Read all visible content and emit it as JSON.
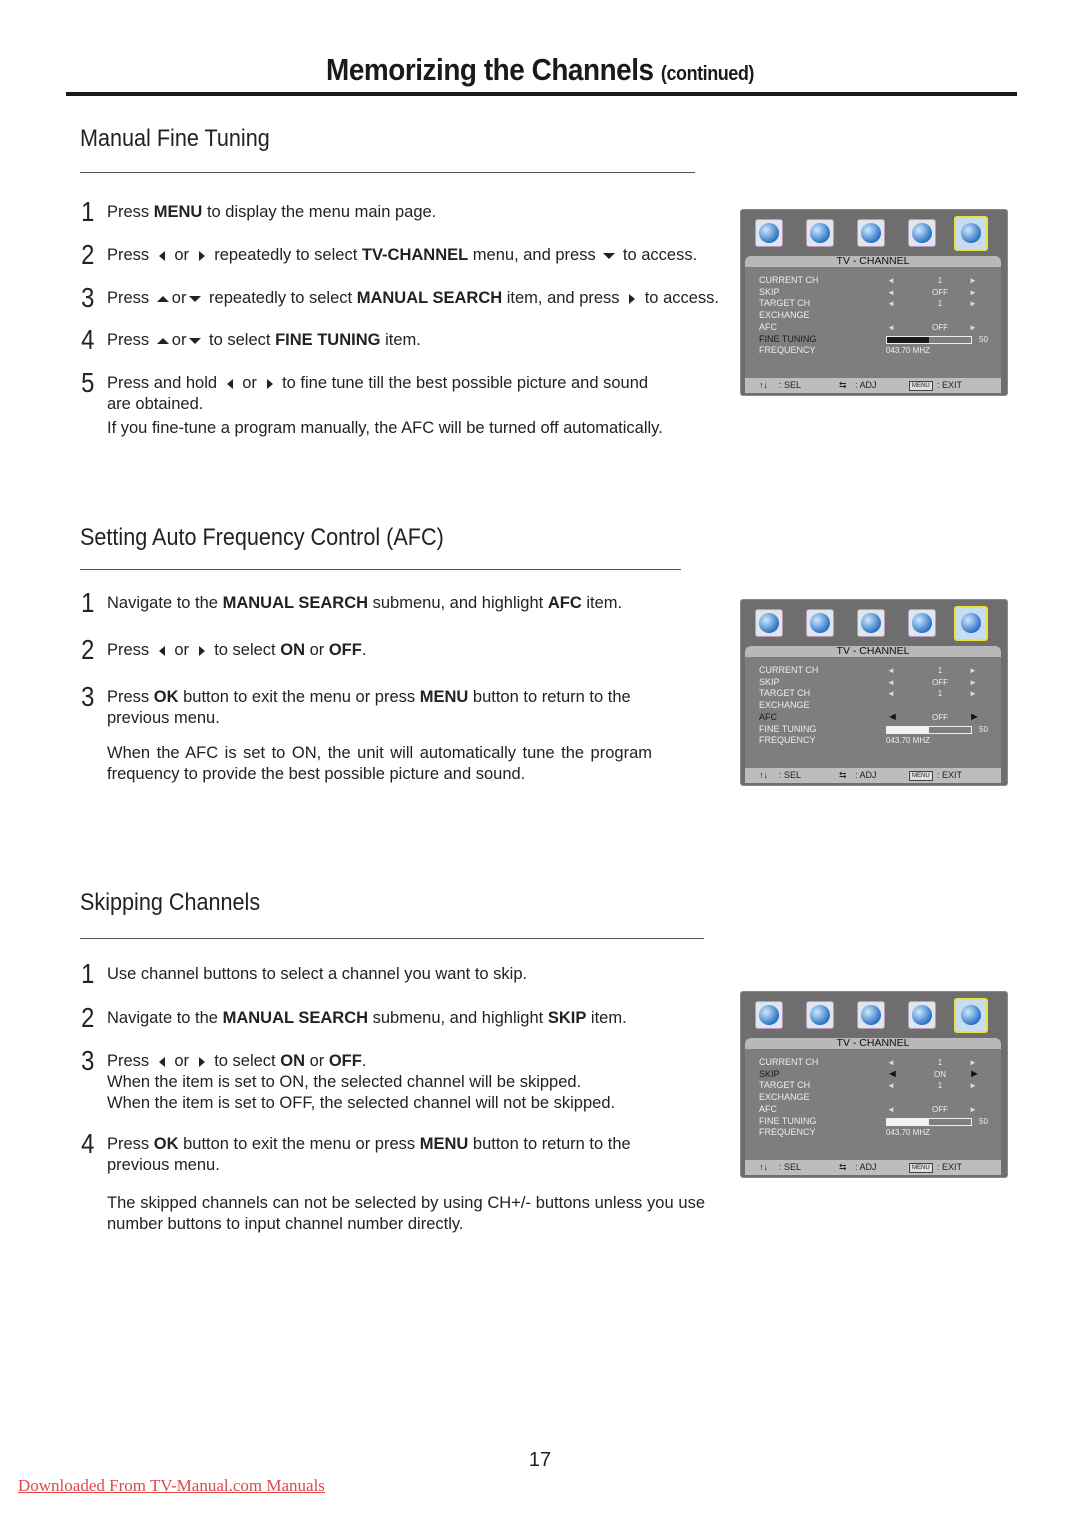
{
  "header": {
    "title": "Memorizing the Channels",
    "title_suffix": "(continued)"
  },
  "sections": [
    {
      "title": "Manual Fine Tuning",
      "steps": [
        {
          "num": "1",
          "parts": [
            "Press ",
            {
              "b": "MENU"
            },
            " to display the menu main page."
          ]
        },
        {
          "num": "2",
          "parts": [
            "Press ",
            {
              "icon": "left"
            },
            " or ",
            {
              "icon": "right"
            },
            " repeatedly to select ",
            {
              "b": "TV-CHANNEL"
            },
            " menu, and press ",
            {
              "icon": "down"
            },
            " to access."
          ]
        },
        {
          "num": "3",
          "parts": [
            "Press ",
            {
              "icon": "up"
            },
            "or",
            {
              "icon": "down"
            },
            " repeatedly to select ",
            {
              "b": "MANUAL SEARCH"
            },
            " item, and  press ",
            {
              "icon": "right"
            },
            " to access."
          ]
        },
        {
          "num": "4",
          "parts": [
            "Press ",
            {
              "icon": "up"
            },
            "or",
            {
              "icon": "down"
            },
            " to select ",
            {
              "b": "FINE TUNING"
            },
            " item."
          ]
        },
        {
          "num": "5",
          "parts": [
            "Press and hold ",
            {
              "icon": "left"
            },
            " or ",
            {
              "icon": "right"
            },
            " to fine tune till the best possible picture and sound"
          ],
          "cont": "are obtained."
        }
      ],
      "note": "If you fine-tune a program manually, the AFC will be turned off automatically.",
      "osd": {
        "highlight": "FINE TUNING",
        "skip": "OFF",
        "bar_fill": "dark"
      }
    },
    {
      "title": "Setting Auto Frequency Control (AFC)",
      "steps": [
        {
          "num": "1",
          "parts": [
            "Navigate to the ",
            {
              "b": "MANUAL SEARCH"
            },
            " submenu, and highlight  ",
            {
              "b": "AFC"
            },
            " item."
          ]
        },
        {
          "num": "2",
          "parts": [
            "Press ",
            {
              "icon": "left"
            },
            " or ",
            {
              "icon": "right"
            },
            " to select ",
            {
              "b": "ON"
            },
            " or ",
            {
              "b": "OFF"
            },
            "."
          ]
        },
        {
          "num": "3",
          "parts": [
            "Press ",
            {
              "b": "OK"
            },
            " button to exit the menu  or press  ",
            {
              "b": "MENU"
            },
            "  button to return to the"
          ],
          "cont": "previous menu."
        }
      ],
      "note": "When the AFC is set to ON, the unit will automatically tune the program frequency to provide the best possible picture and sound.",
      "osd": {
        "highlight": "AFC",
        "skip": "OFF",
        "bar_fill": "light"
      }
    },
    {
      "title": "Skipping Channels",
      "steps": [
        {
          "num": "1",
          "parts": [
            "Use channel buttons to select a channel you want to skip."
          ]
        },
        {
          "num": "2",
          "parts": [
            "Navigate to the ",
            {
              "b": "MANUAL SEARCH"
            },
            " submenu, and highlight ",
            {
              "b": "SKIP"
            },
            " item."
          ]
        },
        {
          "num": "3",
          "parts": [
            "Press ",
            {
              "icon": "left"
            },
            " or ",
            {
              "icon": "right"
            },
            " to select ",
            {
              "b": "ON"
            },
            " or ",
            {
              "b": "OFF"
            },
            "."
          ],
          "extra": [
            "When the item is set to ON, the selected channel will be skipped.",
            "When the item is set to OFF, the selected channel will not  be skipped."
          ]
        },
        {
          "num": "4",
          "parts": [
            "Press ",
            {
              "b": "OK"
            },
            " button to exit the menu  or press  ",
            {
              "b": "MENU"
            },
            "  button to return to the"
          ],
          "cont": "previous menu."
        }
      ],
      "note": "The skipped channels can not be selected by using CH+/- buttons unless you use number buttons to input channel number directly.",
      "osd": {
        "highlight": "SKIP",
        "skip": "ON",
        "bar_fill": "light"
      }
    }
  ],
  "osd_common": {
    "icons": [
      "picture-icon",
      "sound-icon",
      "setup-icon",
      "function-icon",
      "tv-channel-icon"
    ],
    "menu_title": "TV - CHANNEL",
    "rows": [
      {
        "label": "CURRENT  CH",
        "value": "1",
        "arrows": true
      },
      {
        "label": "SKIP",
        "value": "OFF",
        "arrows": true
      },
      {
        "label": "TARGET  CH",
        "value": "1",
        "arrows": true
      },
      {
        "label": "EXCHANGE",
        "value": "",
        "arrows": false
      },
      {
        "label": "AFC",
        "value": "OFF",
        "arrows": true
      },
      {
        "label": "FINE TUNING",
        "bar": 50
      },
      {
        "label": "FREQUENCY",
        "freq": "043.70  MHZ"
      }
    ],
    "fine_tuning_value": "50",
    "fine_tuning_percent": 50,
    "footer": {
      "sel_icon": "↑↓",
      "sel": ":  SEL",
      "adj_icon": "⇆",
      "adj": ":  ADJ",
      "menu_key": "MENU",
      "exit": ":  EXIT"
    }
  },
  "page_number": "17",
  "footer_link": "Downloaded From TV-Manual.com Manuals"
}
